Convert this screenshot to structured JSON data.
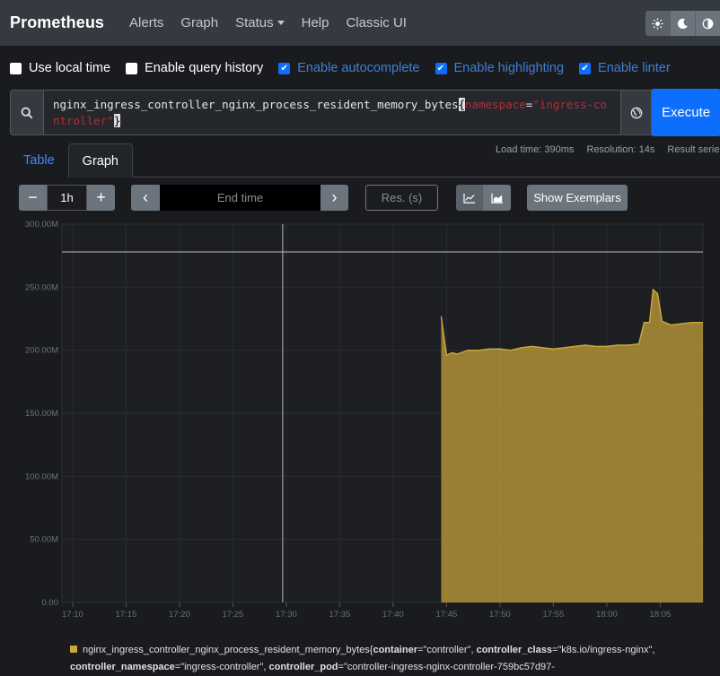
{
  "navbar": {
    "brand": "Prometheus",
    "items": [
      {
        "label": "Alerts"
      },
      {
        "label": "Graph"
      },
      {
        "label": "Status"
      },
      {
        "label": "Help"
      },
      {
        "label": "Classic UI"
      }
    ],
    "theme_icons": [
      "sun-icon",
      "moon-icon",
      "contrast-icon"
    ]
  },
  "options": {
    "use_local_time": {
      "label": "Use local time",
      "checked": false
    },
    "enable_query_history": {
      "label": "Enable query history",
      "checked": false
    },
    "enable_autocomplete": {
      "label": "Enable autocomplete",
      "checked": true
    },
    "enable_highlighting": {
      "label": "Enable highlighting",
      "checked": true
    },
    "enable_linter": {
      "label": "Enable linter",
      "checked": true
    }
  },
  "query": {
    "metric": "nginx_ingress_controller_nginx_process_resident_memory_bytes",
    "open_brace": "{",
    "label_name": "namespace",
    "equals": "=",
    "label_value": "\"ingress-controller\"",
    "close_brace": "}",
    "execute_label": "Execute"
  },
  "tabs": {
    "table": "Table",
    "graph": "Graph"
  },
  "stats": {
    "load_time": "Load time: 390ms",
    "resolution": "Resolution: 14s",
    "result_series": "Result series:"
  },
  "controls": {
    "minus": "−",
    "range": "1h",
    "plus": "+",
    "prev": "‹",
    "end_time_placeholder": "End time",
    "next": "›",
    "res_placeholder": "Res. (s)",
    "show_exemplars": "Show Exemplars"
  },
  "chart_data": {
    "type": "area",
    "y_ticks": [
      "300.00M",
      "250.00M",
      "200.00M",
      "150.00M",
      "100.00M",
      "50.00M",
      "0.00"
    ],
    "x_ticks": [
      "17:10",
      "17:15",
      "17:20",
      "17:25",
      "17:30",
      "17:35",
      "17:40",
      "17:45",
      "17:50",
      "17:55",
      "18:00",
      "18:05"
    ],
    "ylim": [
      0,
      300000000
    ],
    "series": [
      {
        "name": "nginx_ingress_controller_nginx_process_resident_memory_bytes",
        "color": "#c9a53a",
        "x": [
          "17:44:30",
          "17:45:00",
          "17:45:30",
          "17:46:00",
          "17:47:00",
          "17:48:00",
          "17:49:00",
          "17:50:00",
          "17:51:00",
          "17:52:00",
          "17:53:00",
          "17:54:00",
          "17:55:00",
          "17:56:00",
          "17:57:00",
          "17:58:00",
          "17:59:00",
          "18:00:00",
          "18:01:00",
          "18:02:00",
          "18:03:00",
          "18:03:30",
          "18:04:00",
          "18:04:20",
          "18:04:45",
          "18:05:10",
          "18:06:00",
          "18:07:00",
          "18:08:00",
          "18:09:00"
        ],
        "values": [
          227000000,
          196000000,
          198000000,
          197000000,
          200000000,
          200000000,
          201000000,
          201000000,
          200000000,
          202000000,
          203000000,
          202000000,
          201000000,
          202000000,
          203000000,
          204000000,
          203000000,
          203000000,
          204000000,
          204000000,
          205000000,
          222000000,
          222000000,
          248000000,
          245000000,
          223000000,
          220000000,
          221000000,
          222000000,
          222000000
        ]
      }
    ]
  },
  "legend": {
    "metric": "nginx_ingress_controller_nginx_process_resident_memory_bytes{",
    "k1": "container",
    "v1": "=\"controller\", ",
    "k2": "controller_class",
    "v2": "=\"k8s.io/ingress-nginx\", ",
    "k3": "controller_namespace",
    "v3": "=\"ingress-controller\", ",
    "k4": "controller_pod",
    "v4": "=\"controller-ingress-nginx-controller-759bc57d97-"
  }
}
